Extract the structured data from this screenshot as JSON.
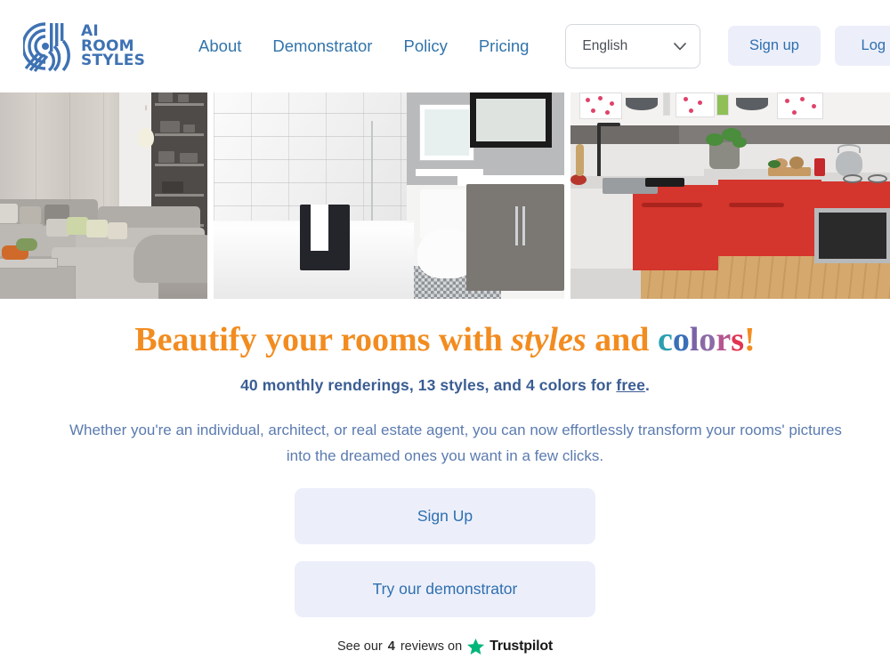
{
  "brand": {
    "name_lines": [
      "AI",
      "ROOM",
      "STYLES"
    ],
    "logo_icon": "concentric-arcs-logo-icon",
    "color": "#3e72b3"
  },
  "nav": {
    "items": [
      {
        "label": "About"
      },
      {
        "label": "Demonstrator"
      },
      {
        "label": "Policy"
      },
      {
        "label": "Pricing"
      }
    ]
  },
  "language_select": {
    "value": "English",
    "icon": "chevron-down-icon"
  },
  "header_actions": [
    {
      "label": "Sign up"
    },
    {
      "label": "Log in"
    }
  ],
  "hero_images": [
    {
      "alt": "living-room-grey-sectional-sofa"
    },
    {
      "alt": "white-bathroom-subway-tile-toilet-vanity"
    },
    {
      "alt": "kitchen-red-cabinets-wood-floor"
    }
  ],
  "headline": {
    "part1": "Beautify your rooms with ",
    "styles": "styles",
    "and": " and ",
    "colors_letters": [
      {
        "ch": "c",
        "color": "#2a9fb0"
      },
      {
        "ch": "o",
        "color": "#3a6fb8"
      },
      {
        "ch": "l",
        "color": "#7b62a8"
      },
      {
        "ch": "o",
        "color": "#8c6aa6"
      },
      {
        "ch": "r",
        "color": "#b5568f"
      },
      {
        "ch": "s",
        "color": "#e03452"
      },
      {
        "ch": "!",
        "color": "#f28c20"
      }
    ],
    "base_color": "#f28c20"
  },
  "subline": {
    "before": "40 monthly renderings, 13 styles, and 4 colors for ",
    "link": "free",
    "after": "."
  },
  "paragraph": {
    "line1": "Whether you're an individual, architect, or real estate agent, you can now effortlessly transform your rooms' pictures",
    "line2": "into the dreamed ones you want in a few clicks."
  },
  "cta_buttons": [
    {
      "label": "Sign Up"
    },
    {
      "label": "Try our demonstrator"
    }
  ],
  "trustpilot": {
    "prefix": "See our",
    "count": "4",
    "middle": "reviews on",
    "star_icon": "trustpilot-star-icon",
    "star_color": "#00b67a",
    "name": "Trustpilot"
  }
}
